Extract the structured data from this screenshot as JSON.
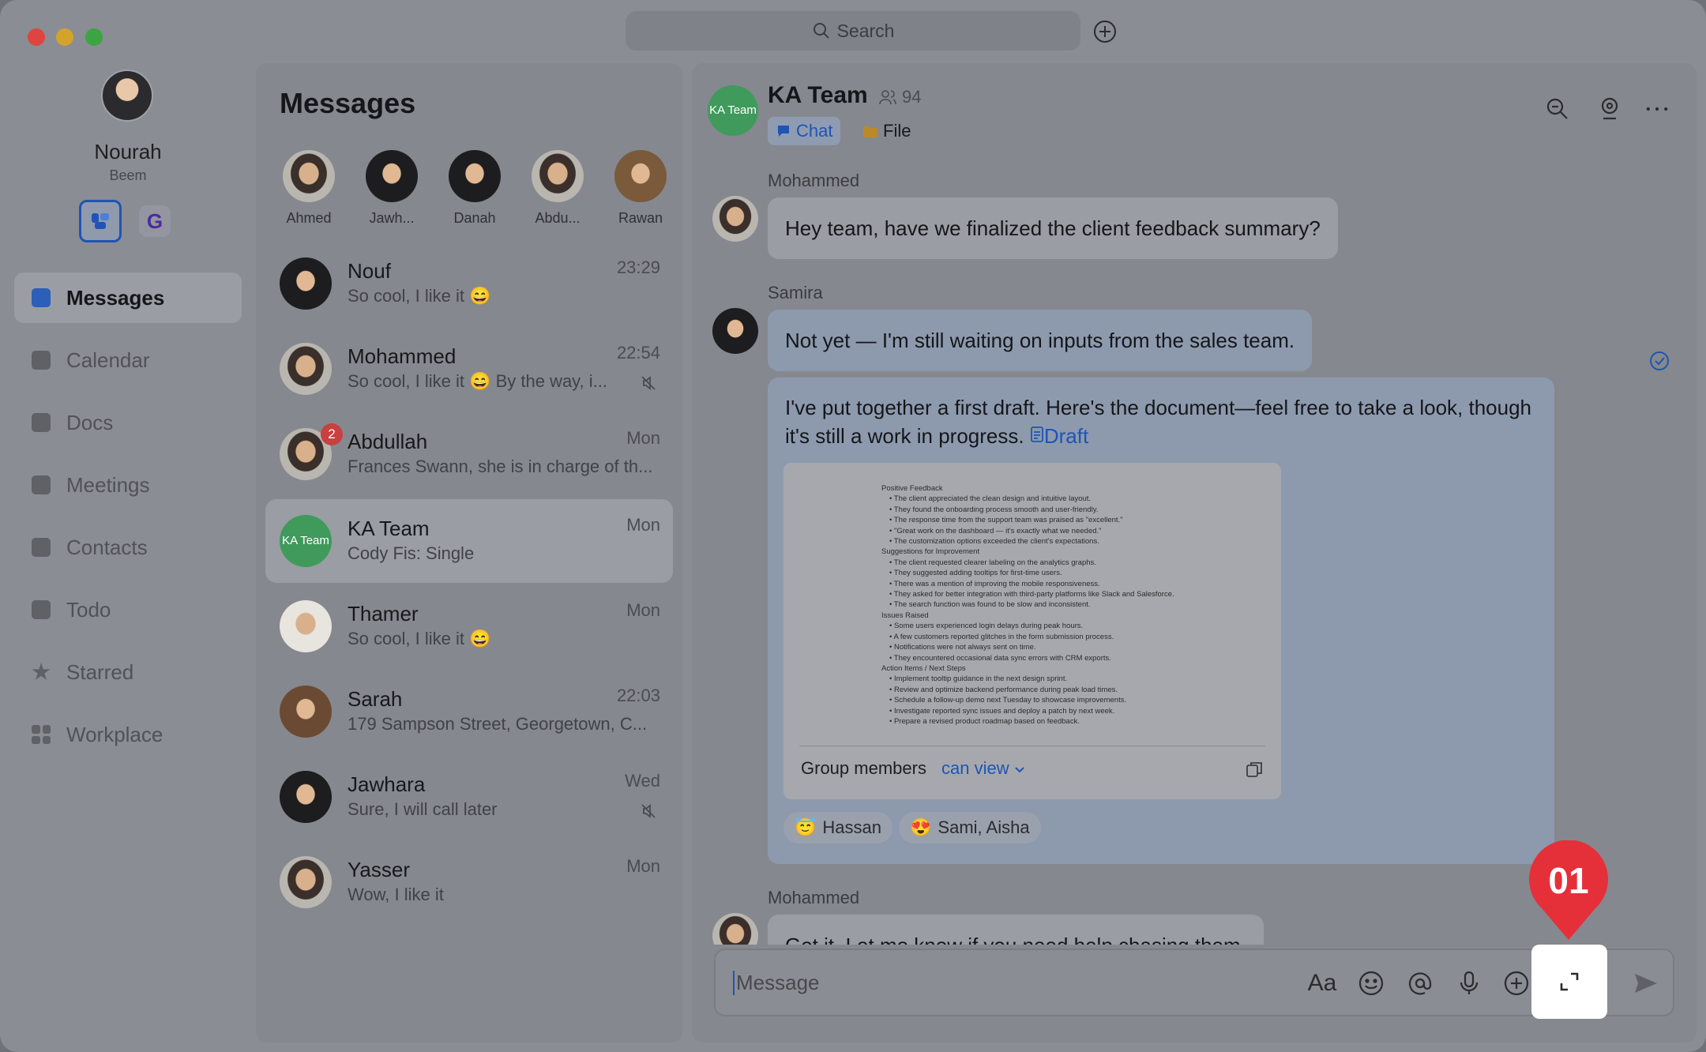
{
  "search": {
    "label": "Search"
  },
  "profile": {
    "name": "Nourah",
    "org": "Beem",
    "org_badges": [
      "",
      "G"
    ]
  },
  "nav": {
    "items": [
      {
        "label": "Messages",
        "icon": "chat-icon"
      },
      {
        "label": "Calendar",
        "icon": "calendar-icon"
      },
      {
        "label": "Docs",
        "icon": "docs-icon"
      },
      {
        "label": "Meetings",
        "icon": "video-icon"
      },
      {
        "label": "Contacts",
        "icon": "contacts-icon"
      },
      {
        "label": "Todo",
        "icon": "check-icon"
      },
      {
        "label": "Starred",
        "icon": "star-icon"
      },
      {
        "label": "Workplace",
        "icon": "grid-icon"
      }
    ]
  },
  "list": {
    "title": "Messages",
    "pinned": [
      {
        "name": "Ahmed"
      },
      {
        "name": "Jawh..."
      },
      {
        "name": "Danah"
      },
      {
        "name": "Abdu..."
      },
      {
        "name": "Rawan"
      }
    ],
    "conversations": [
      {
        "name": "Nouf",
        "preview": "So cool, I like it 😄",
        "time": "23:29"
      },
      {
        "name": "Mohammed",
        "preview": "So cool, I like it 😄 By the way, i...",
        "time": "22:54",
        "muted": true
      },
      {
        "name": "Abdullah",
        "preview": "Frances Swann, she is in charge of th...",
        "time": "Mon",
        "badge": "2"
      },
      {
        "name": "KA Team",
        "preview": "Cody Fis: Single",
        "time": "Mon",
        "avatar_text": "KA Team"
      },
      {
        "name": "Thamer",
        "preview": "So cool, I like it 😄",
        "time": "Mon"
      },
      {
        "name": "Sarah",
        "preview": "179 Sampson Street, Georgetown, C...",
        "time": "22:03"
      },
      {
        "name": "Jawhara",
        "preview": "Sure, I will call later",
        "time": "Wed",
        "muted": true
      },
      {
        "name": "Yasser",
        "preview": "Wow, I like it",
        "time": "Mon"
      }
    ]
  },
  "chat": {
    "avatar_text": "KA Team",
    "title": "KA Team",
    "member_count": "94",
    "tabs": {
      "chat": "Chat",
      "file": "File"
    },
    "messages": [
      {
        "sender": "Mohammed",
        "text": "Hey team, have we finalized the client feedback summary?"
      },
      {
        "sender": "Samira",
        "text": "Not yet — I'm still waiting on inputs from the sales team."
      },
      {
        "text": "I've put together a first draft. Here's the document—feel free to take a look, though it's still a work in progress.",
        "link": "Draft"
      },
      {
        "sender": "Mohammed",
        "text": "Got it. Let me know if you need help chasing them."
      }
    ],
    "doc": {
      "lines": [
        "Positive Feedback",
        "• The client appreciated the clean design and intuitive layout.",
        "• They found the onboarding process smooth and user-friendly.",
        "• The response time from the support team was praised as \"excellent.\"",
        "• \"Great work on the dashboard — it's exactly what we needed.\"",
        "• The customization options exceeded the client's expectations.",
        "Suggestions for Improvement",
        "• The client requested clearer labeling on the analytics graphs.",
        "• They suggested adding tooltips for first-time users.",
        "• There was a mention of improving the mobile responsiveness.",
        "• They asked for better integration with third-party platforms like Slack and Salesforce.",
        "• The search function was found to be slow and inconsistent.",
        "Issues Raised",
        "• Some users experienced login delays during peak hours.",
        "• A few customers reported glitches in the form submission process.",
        "• Notifications were not always sent on time.",
        "• They encountered occasional data sync errors with CRM exports.",
        "Action Items / Next Steps",
        "• Implement tooltip guidance in the next design sprint.",
        "• Review and optimize backend performance during peak load times.",
        "• Schedule a follow-up demo next Tuesday to showcase improvements.",
        "• Investigate reported sync issues and deploy a patch by next week.",
        "• Prepare a revised product roadmap based on feedback."
      ],
      "permission_label": "Group members",
      "permission_value": "can view"
    },
    "reactions": [
      {
        "emoji": "😇",
        "names": "Hassan"
      },
      {
        "emoji": "😍",
        "names": "Sami, Aisha"
      }
    ],
    "input": {
      "placeholder": "Message"
    }
  },
  "annotation": {
    "marker": "01"
  },
  "colors": {
    "accent": "#1f54b5",
    "marker": "#e5303a",
    "team_green": "#3f9a5c"
  }
}
